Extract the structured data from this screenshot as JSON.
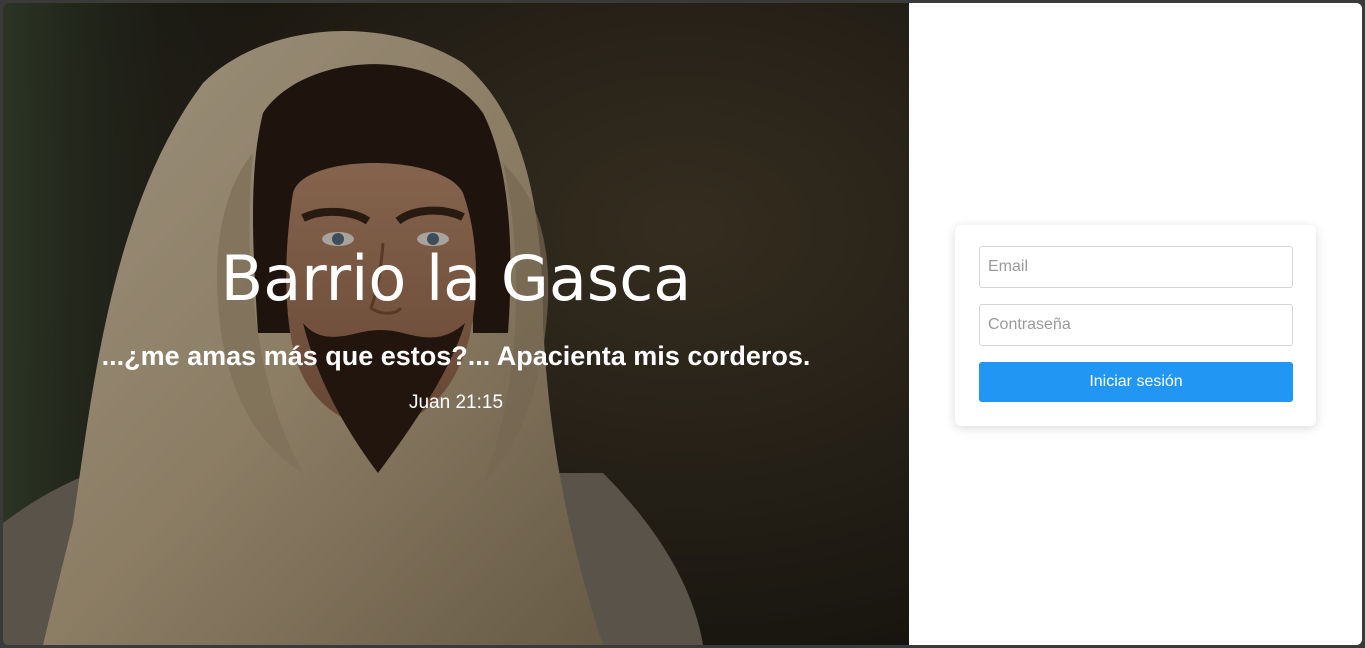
{
  "hero": {
    "title": "Barrio la Gasca",
    "quote": "...¿me amas más que estos?... Apacienta mis corderos.",
    "reference": "Juan 21:15",
    "image_description_icon": "portrait-photo"
  },
  "login": {
    "email_placeholder": "Email",
    "password_placeholder": "Contraseña",
    "submit_label": "Iniciar sesión",
    "accent_color": "#2196f3"
  }
}
